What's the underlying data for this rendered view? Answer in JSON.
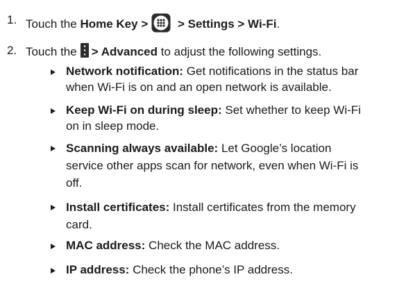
{
  "steps": [
    {
      "number": "1.",
      "prefix": "Touch the ",
      "bold1": "Home Key >",
      "icon": "apps-grid-icon",
      "bold2": " > Settings > Wi-Fi",
      "suffix": "."
    },
    {
      "number": "2.",
      "prefix": "Touch the",
      "icon": "menu-overflow-icon",
      "bold1": "> Advanced",
      "suffix": " to adjust the following settings."
    }
  ],
  "bullets": [
    {
      "term": "Network notification:",
      "desc": " Get notifications in the status bar when Wi-Fi is on and an open network is available."
    },
    {
      "term": "Keep Wi-Fi on during sleep:",
      "desc": " Set whether to keep Wi-Fi on in sleep mode."
    },
    {
      "term": "Scanning always available:",
      "desc": " Let Google’s location service other apps scan for network, even when Wi-Fi is off."
    },
    {
      "term": "Install certificates:",
      "desc": " Install certificates from the memory card."
    },
    {
      "term": "MAC address:",
      "desc": " Check the MAC address."
    },
    {
      "term": "IP address:",
      "desc": " Check the phone’s IP address."
    }
  ],
  "colors": {
    "text": "#1a1a1a",
    "icon_fill": "#2b2b2b"
  }
}
